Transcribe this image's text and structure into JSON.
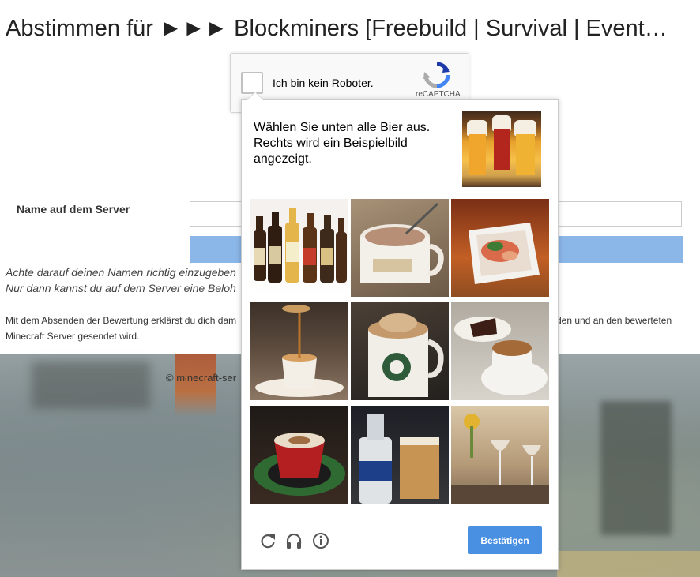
{
  "page": {
    "title": "Abstimmen für ►►► Blockminers [Freebuild | Survival | Event…",
    "name_label": "Name auf dem Server",
    "name_value": "",
    "hint_line1": "Achte darauf deinen Namen richtig einzugeben",
    "hint_line2": "Nur dann kannst du auf dem Server eine Beloh",
    "consent_line1": "Mit dem Absenden der Bewertung erklärst du dich dam",
    "consent_line1_end": "den und an den bewerteten",
    "consent_line2": "Minecraft Server gesendet wird.",
    "footer": "© minecraft-ser"
  },
  "recaptcha": {
    "checkbox_label": "Ich bin kein Roboter.",
    "brand": "reCAPTCHA",
    "checked": false
  },
  "challenge": {
    "instruction": "Wählen Sie unten alle Bier aus. Rechts wird ein Beispielbild angezeigt.",
    "sample_image": "beer-glasses-sample",
    "tiles": [
      {
        "image": "beer-bottles",
        "selected": false
      },
      {
        "image": "cocoa-mug",
        "selected": false
      },
      {
        "image": "food-plate",
        "selected": false
      },
      {
        "image": "coffee-pour",
        "selected": false
      },
      {
        "image": "starbucks-mug",
        "selected": false
      },
      {
        "image": "coffee-and-cake",
        "selected": false
      },
      {
        "image": "cappuccino-red-cup",
        "selected": false
      },
      {
        "image": "beer-bottle-and-glass",
        "selected": false
      },
      {
        "image": "wine-glasses-table",
        "selected": false
      }
    ],
    "controls": {
      "reload_icon": "reload-icon",
      "audio_icon": "headphones-icon",
      "info_icon": "info-icon"
    },
    "verify_label": "Bestätigen",
    "accent": "#4a90e2"
  }
}
